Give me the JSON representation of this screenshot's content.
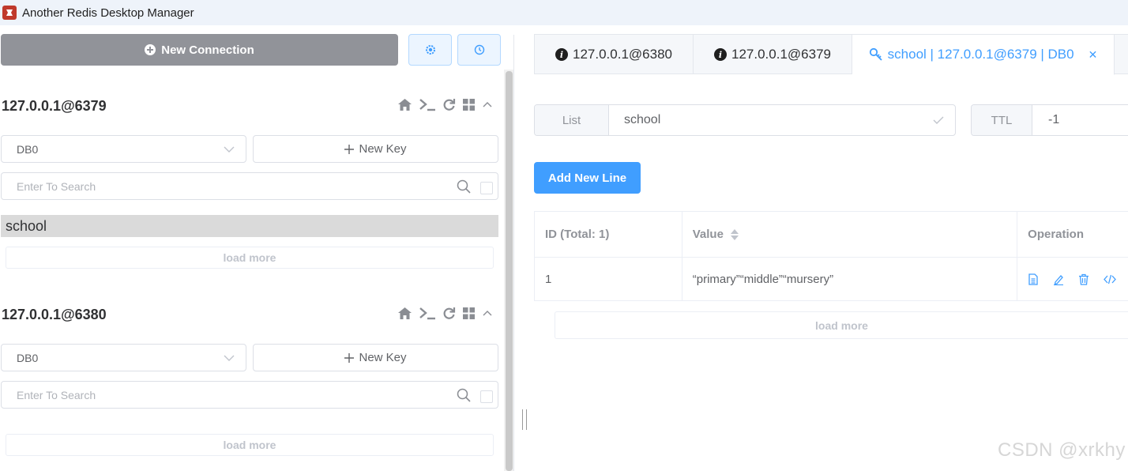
{
  "window": {
    "title": "Another Redis Desktop Manager"
  },
  "sidebar": {
    "new_connection_label": "New Connection",
    "connections": [
      {
        "name": "127.0.0.1@6379",
        "db": "DB0",
        "new_key_label": "New Key",
        "search_placeholder": "Enter To Search",
        "keys": [
          "school"
        ],
        "load_more": "load more"
      },
      {
        "name": "127.0.0.1@6380",
        "db": "DB0",
        "new_key_label": "New Key",
        "search_placeholder": "Enter To Search",
        "keys": [],
        "load_more": "load more"
      }
    ]
  },
  "tabs": [
    {
      "label": "127.0.0.1@6380",
      "icon": "info-icon",
      "active": false
    },
    {
      "label": "127.0.0.1@6379",
      "icon": "info-icon",
      "active": false
    },
    {
      "label": "school | 127.0.0.1@6379 | DB0",
      "icon": "key-icon",
      "active": true
    }
  ],
  "key_detail": {
    "type_label": "List",
    "key_name": "school",
    "ttl_label": "TTL",
    "ttl_value": "-1",
    "add_line_label": "Add New Line",
    "table": {
      "headers": [
        "ID (Total: 1)",
        "Value",
        "Operation"
      ],
      "rows": [
        {
          "id": "1",
          "value": "“primary”“middle”“mursery”"
        }
      ]
    },
    "load_more": "load more"
  },
  "watermark": "CSDN @xrkhy",
  "colors": {
    "primary": "#409eff",
    "new_connection_bg": "#919399",
    "selected_key_bg": "#dadada"
  }
}
